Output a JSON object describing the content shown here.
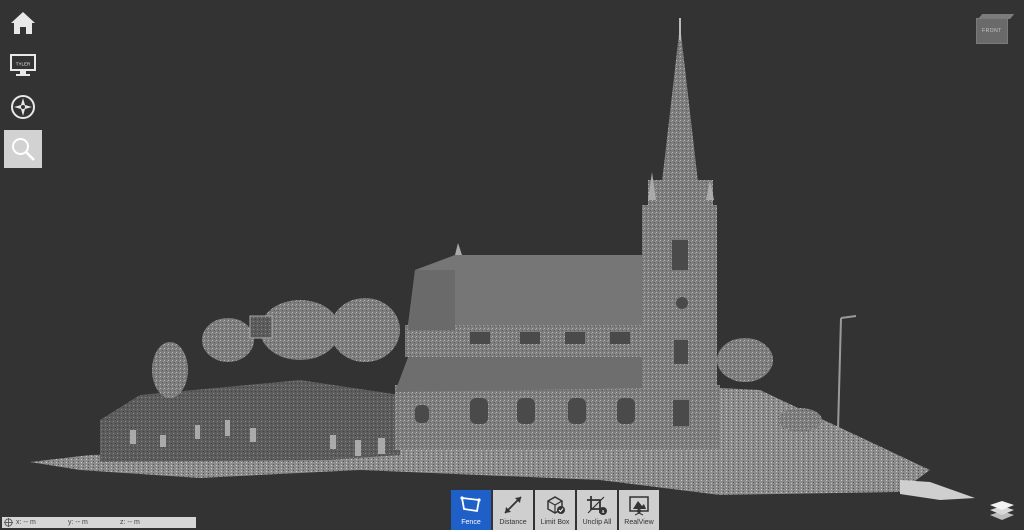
{
  "left_toolbar": {
    "items": [
      {
        "name": "home-button",
        "icon": "home-icon"
      },
      {
        "name": "display-button",
        "icon": "monitor-icon",
        "text": "TYLER"
      },
      {
        "name": "navigation-button",
        "icon": "compass-icon"
      },
      {
        "name": "search-button",
        "icon": "magnifier-icon",
        "active": true
      }
    ]
  },
  "viewcube": {
    "label": "FRONT"
  },
  "bottom_toolbar": {
    "items": [
      {
        "label": "Fence",
        "icon": "fence-icon",
        "active": true
      },
      {
        "label": "Distance",
        "icon": "distance-icon"
      },
      {
        "label": "Limit Box",
        "icon": "limit-box-icon"
      },
      {
        "label": "Unclip All",
        "icon": "unclip-icon"
      },
      {
        "label": "RealView",
        "icon": "realview-icon"
      }
    ]
  },
  "coordinates": {
    "x": "x: -- m",
    "y": "y: -- m",
    "z": "z: -- m"
  },
  "colors": {
    "background": "#333333",
    "accent": "#1f5fc8",
    "button": "#cfcfcf"
  }
}
